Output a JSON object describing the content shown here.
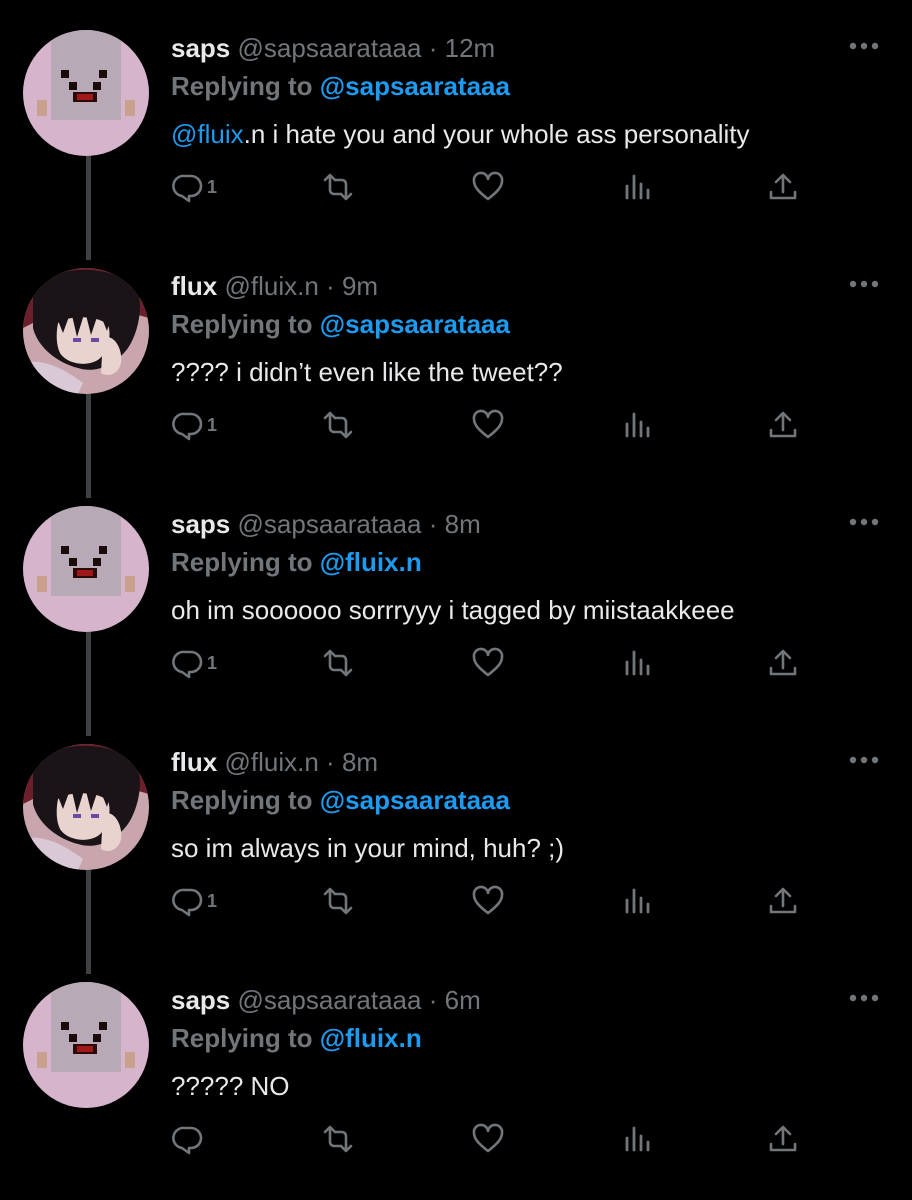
{
  "tweets": [
    {
      "name": "saps",
      "handle": "@sapsaarataaa",
      "separator": "·",
      "time": "12m",
      "replying_label": "Replying to",
      "replying_to": "@sapsaarataaa",
      "body_mention": "@fluix",
      "body_text": ".n i hate you and your whole ass personality",
      "reply_count": "1",
      "avatar": "pixel-face"
    },
    {
      "name": "flux",
      "handle": "@fluix.n",
      "separator": "·",
      "time": "9m",
      "replying_label": "Replying to",
      "replying_to": "@sapsaarataaa",
      "body_mention": "",
      "body_text": "???? i didn’t even like the tweet??",
      "reply_count": "1",
      "avatar": "anime-character"
    },
    {
      "name": "saps",
      "handle": "@sapsaarataaa",
      "separator": "·",
      "time": "8m",
      "replying_label": "Replying to",
      "replying_to": "@fluix.n",
      "body_mention": "",
      "body_text": "oh im soooooo sorrryyy i tagged by miistaakkeee",
      "reply_count": "1",
      "avatar": "pixel-face"
    },
    {
      "name": "flux",
      "handle": "@fluix.n",
      "separator": "·",
      "time": "8m",
      "replying_label": "Replying to",
      "replying_to": "@sapsaarataaa",
      "body_mention": "",
      "body_text": "so im always in your mind, huh? ;)",
      "reply_count": "1",
      "avatar": "anime-character"
    },
    {
      "name": "saps",
      "handle": "@sapsaarataaa",
      "separator": "·",
      "time": "6m",
      "replying_label": "Replying to",
      "replying_to": "@fluix.n",
      "body_mention": "",
      "body_text": "????? NO",
      "reply_count": "",
      "avatar": "pixel-face"
    }
  ],
  "colors": {
    "background": "#000000",
    "text": "#e7e9ea",
    "muted": "#71767b",
    "link": "#1d9bf0",
    "thread_line": "#3e4144"
  },
  "icons": [
    "reply-icon",
    "retweet-icon",
    "like-icon",
    "views-icon",
    "share-icon",
    "more-icon"
  ]
}
